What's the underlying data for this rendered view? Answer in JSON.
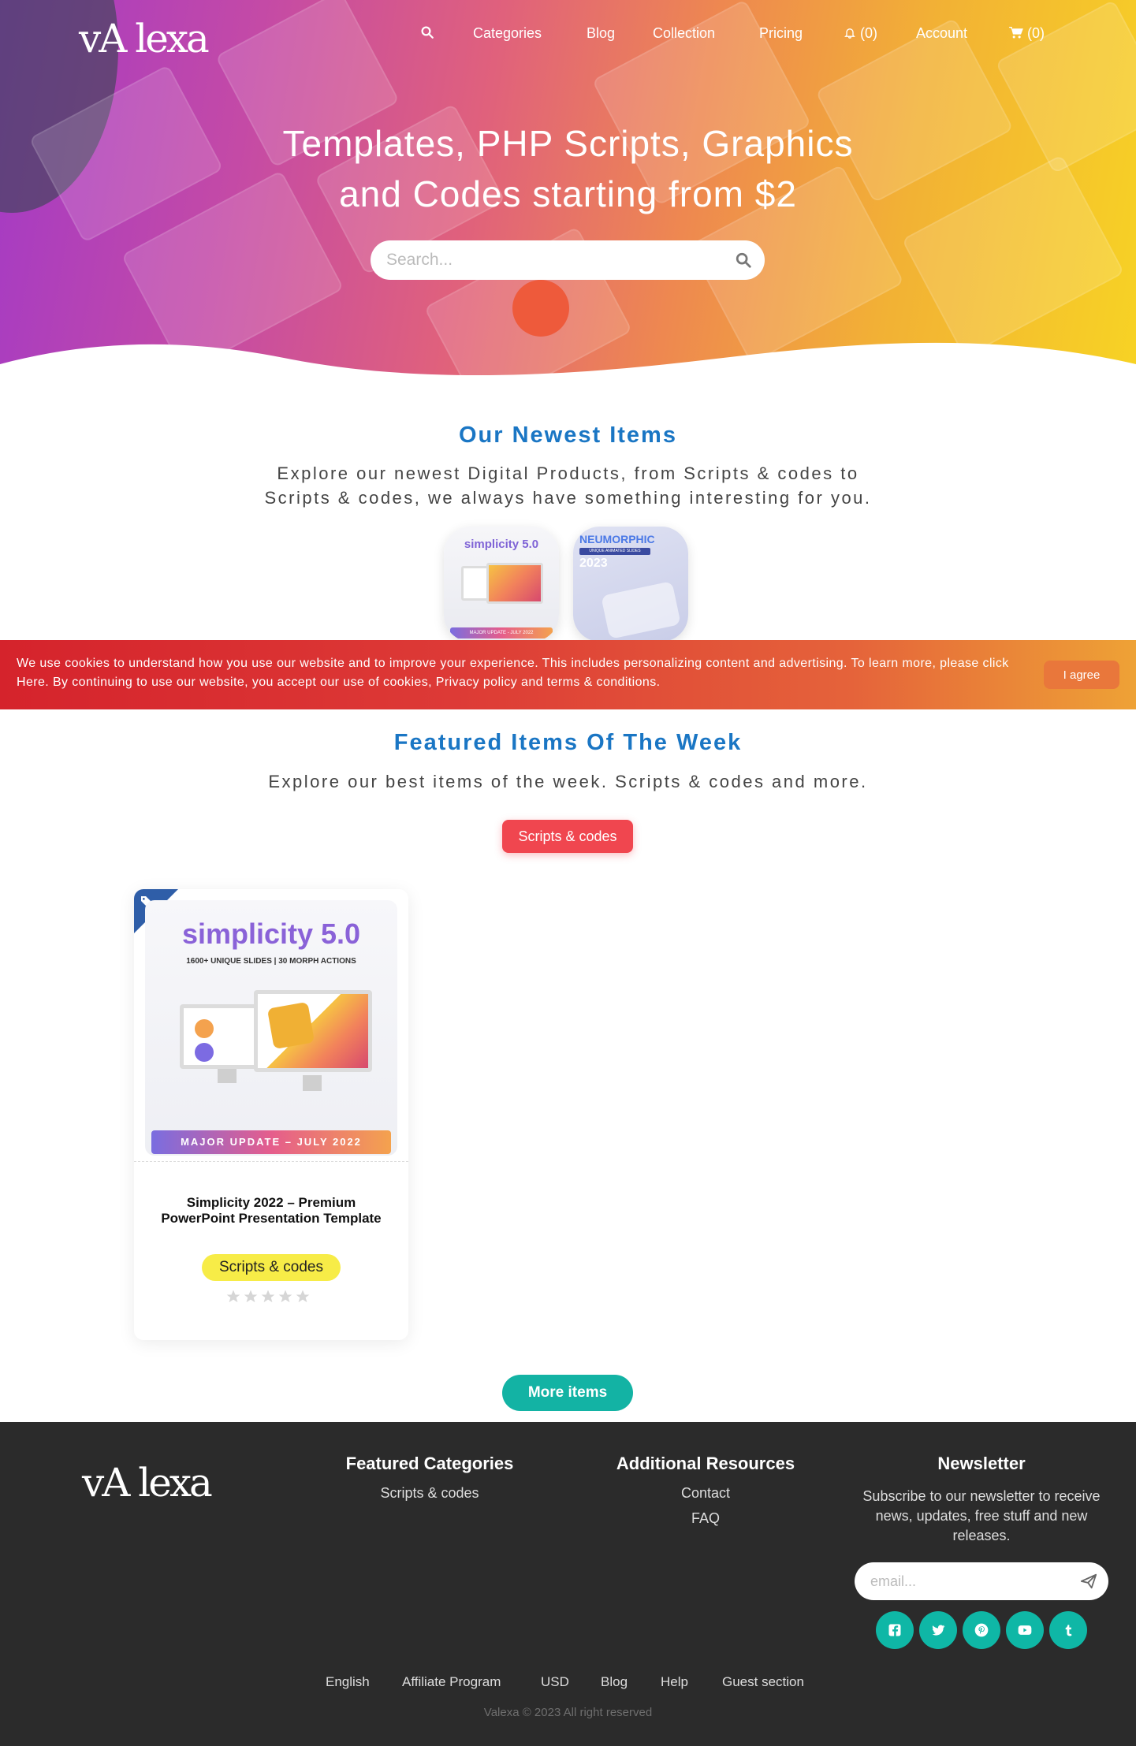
{
  "brand": {
    "logo_text": "vA lexa"
  },
  "nav": {
    "categories": "Categories",
    "blog": "Blog",
    "collection": "Collection",
    "pricing": "Pricing",
    "notifications": "(0)",
    "account": "Account",
    "cart": "(0)"
  },
  "hero": {
    "title_line1": "Templates, PHP Scripts, Graphics",
    "title_line2": "and Codes starting from $2",
    "search_placeholder": "Search..."
  },
  "newest": {
    "title": "Our Newest Items",
    "desc_line1": "Explore our newest Digital Products, from Scripts & codes to",
    "desc_line2": "Scripts & codes, we always have something interesting for you.",
    "thumb1_title": "simplicity 5.0",
    "thumb1_banner": "MAJOR UPDATE - JULY 2022",
    "thumb2_title": "NEUMORPHIC",
    "thumb2_sub": "UNIQUE ANIMATED SLIDES",
    "thumb2_year": "2023"
  },
  "cookie": {
    "text": "We use cookies to understand how you use our website and to improve your experience. This includes personalizing content and advertising. To learn more, please click Here. By continuing to use our website, you accept our use of cookies, Privacy policy and terms & conditions.",
    "button": "I agree"
  },
  "featured": {
    "title": "Featured Items Of The Week",
    "desc": "Explore our best items of the week. Scripts & codes and more.",
    "filter": "Scripts & codes",
    "more_button": "More items"
  },
  "card": {
    "image_title": "simplicity 5.0",
    "image_subtitle": "1600+ UNIQUE SLIDES  |  30 MORPH ACTIONS",
    "image_banner": "MAJOR UPDATE – JULY 2022",
    "title": "Simplicity 2022 – Premium PowerPoint Presentation Template",
    "category": "Scripts & codes",
    "rating": 0,
    "rating_max": 5
  },
  "footer": {
    "logo_text": "vA lexa",
    "featured_heading": "Featured Categories",
    "featured_links": [
      "Scripts & codes"
    ],
    "resources_heading": "Additional Resources",
    "resources_links": [
      "Contact",
      "FAQ"
    ],
    "newsletter_heading": "Newsletter",
    "newsletter_text": "Subscribe to our newsletter to receive news, updates, free stuff and new releases.",
    "email_placeholder": "email...",
    "social": [
      "facebook-icon",
      "twitter-icon",
      "pinterest-icon",
      "youtube-icon",
      "tumblr-icon"
    ],
    "bottom_links": [
      "English",
      "Affiliate Program",
      "USD",
      "Blog",
      "Help",
      "Guest section"
    ],
    "copyright": "Valexa © 2023 All right reserved"
  },
  "colors": {
    "accent_blue": "#1a76c4",
    "filter_red": "#f0464f",
    "teal": "#13b3a4",
    "category_yellow": "#f7ec47",
    "footer_bg": "#2b2b2b"
  }
}
